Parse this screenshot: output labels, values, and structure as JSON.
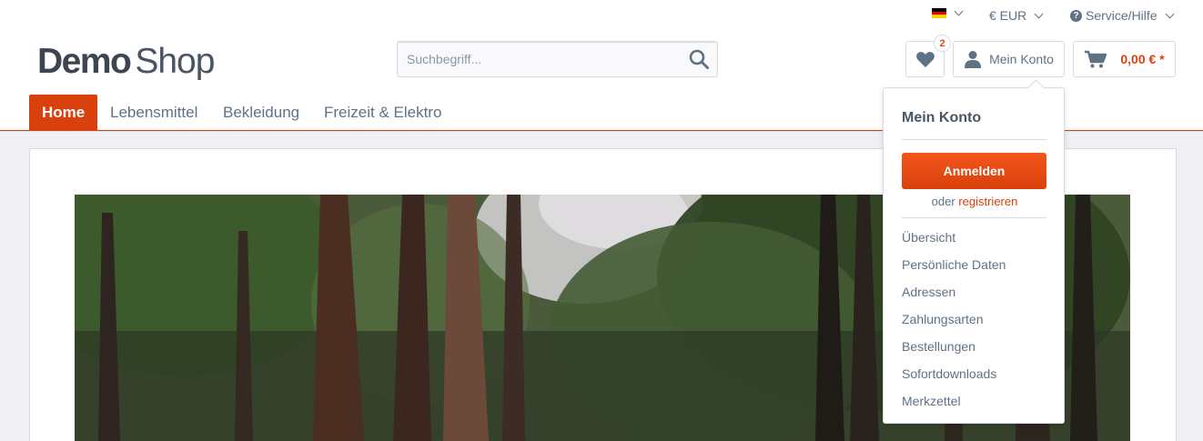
{
  "topbar": {
    "language_flag": "de",
    "flag_colors": [
      "#000000",
      "#dd0000",
      "#ffce00"
    ],
    "currency_label": "€ EUR",
    "service_label": "Service/Hilfe"
  },
  "header": {
    "logo_bold": "Demo",
    "logo_light": "Shop",
    "search": {
      "placeholder": "Suchbegriff..."
    },
    "wishlist_count": "2",
    "account_label": "Mein Konto",
    "cart_total": "0,00 € *"
  },
  "nav": {
    "items": [
      {
        "label": "Home",
        "active": true
      },
      {
        "label": "Lebensmittel"
      },
      {
        "label": "Bekleidung"
      },
      {
        "label": "Freizeit & Elektro"
      }
    ]
  },
  "account_dropdown": {
    "title": "Mein Konto",
    "login_button": "Anmelden",
    "or_text": "oder",
    "register_link": "registrieren",
    "links": [
      "Übersicht",
      "Persönliche Daten",
      "Adressen",
      "Zahlungsarten",
      "Bestellungen",
      "Sofortdownloads",
      "Merkzettel"
    ]
  },
  "colors": {
    "accent": "#d9400b",
    "text": "#5f7285",
    "border": "#dadae5"
  }
}
